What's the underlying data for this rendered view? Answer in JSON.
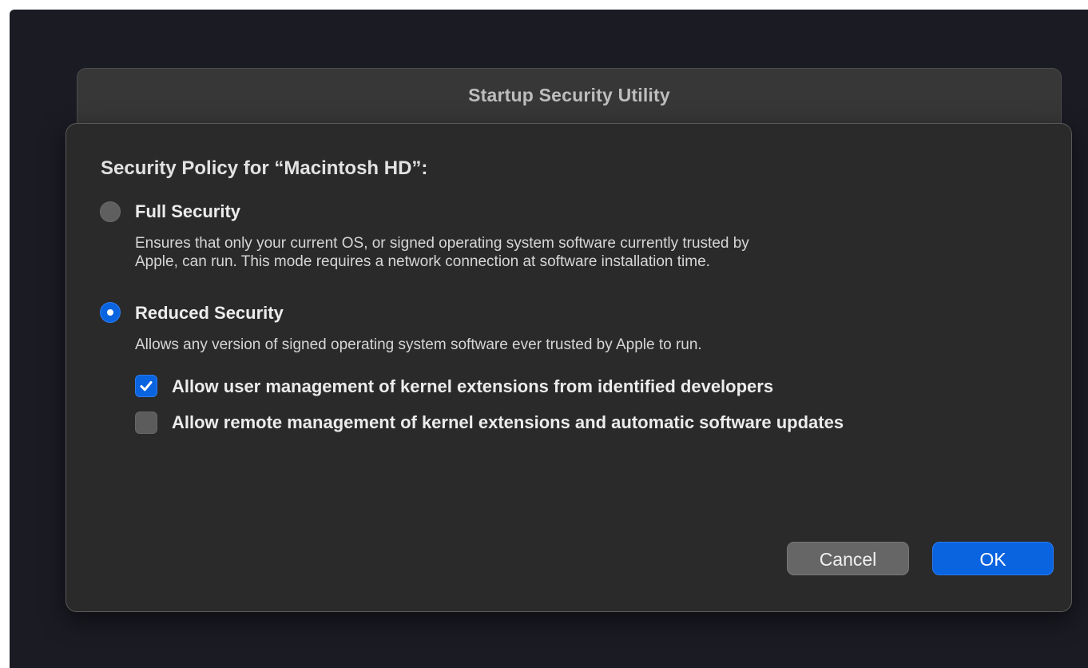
{
  "window": {
    "title": "Startup Security Utility"
  },
  "dialog": {
    "heading": "Security Policy for “Macintosh HD”:",
    "options": [
      {
        "label": "Full Security",
        "description_line1": "Ensures that only your current OS, or signed operating system software currently trusted by",
        "description_line2": "Apple, can run. This mode requires a network connection at software installation time.",
        "selected": false
      },
      {
        "label": "Reduced Security",
        "description": "Allows any version of signed operating system software ever trusted by Apple to run.",
        "selected": true
      }
    ],
    "checkboxes": [
      {
        "label": "Allow user management of kernel extensions from identified developers",
        "checked": true
      },
      {
        "label": "Allow remote management of kernel extensions and automatic software updates",
        "checked": false
      }
    ],
    "buttons": {
      "cancel": "Cancel",
      "ok": "OK"
    }
  },
  "colors": {
    "accent": "#0a64e0",
    "background": "#1b1b24",
    "sheet": "#2a2a2a"
  }
}
